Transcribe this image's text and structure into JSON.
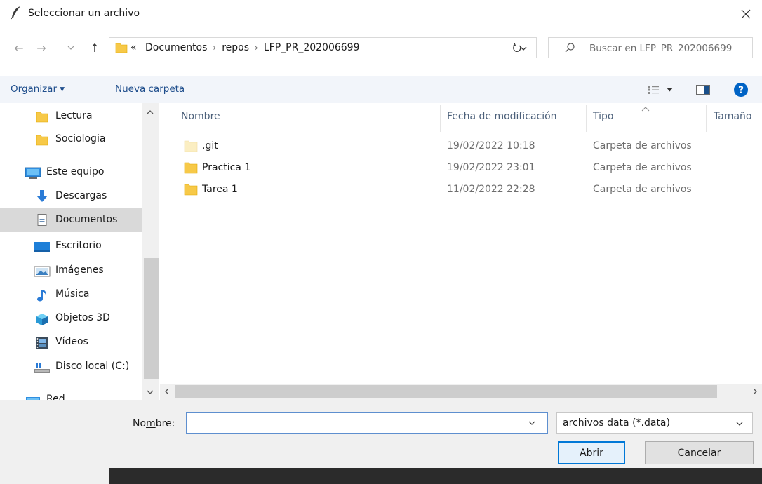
{
  "window": {
    "title": "Seleccionar un archivo",
    "close_glyph": "✕"
  },
  "nav": {
    "back_glyph": "←",
    "forward_glyph": "→",
    "recent_glyph": "⌄",
    "up_glyph": "↑",
    "address": {
      "prefix": "«",
      "crumbs": [
        "Documentos",
        "repos",
        "LFP_PR_202006699"
      ],
      "separator": "›"
    },
    "refresh_glyph": "↻",
    "search_placeholder": "Buscar en LFP_PR_202006699"
  },
  "toolbar": {
    "organize": "Organizar ▾",
    "new_folder": "Nueva carpeta",
    "help": "?"
  },
  "sidebar": {
    "items": [
      {
        "label": "Lectura",
        "icon": "folder-icon"
      },
      {
        "label": "Sociologia",
        "icon": "folder-icon"
      },
      {
        "label": "Este equipo",
        "icon": "computer-icon"
      },
      {
        "label": "Descargas",
        "icon": "download-icon"
      },
      {
        "label": "Documentos",
        "icon": "documents-icon",
        "selected": true
      },
      {
        "label": "Escritorio",
        "icon": "desktop-icon"
      },
      {
        "label": "Imágenes",
        "icon": "pictures-icon"
      },
      {
        "label": "Música",
        "icon": "music-icon"
      },
      {
        "label": "Objetos 3D",
        "icon": "objects-3d-icon"
      },
      {
        "label": "Vídeos",
        "icon": "videos-icon"
      },
      {
        "label": "Disco local (C:)",
        "icon": "drive-icon"
      },
      {
        "label": "Red",
        "icon": "network-icon"
      }
    ]
  },
  "columns": {
    "name": "Nombre",
    "date": "Fecha de modificación",
    "type": "Tipo",
    "size": "Tamaño"
  },
  "files": [
    {
      "name": ".git",
      "date": "19/02/2022 10:18",
      "type": "Carpeta de archivos",
      "hidden": true
    },
    {
      "name": "Practica 1",
      "date": "19/02/2022 23:01",
      "type": "Carpeta de archivos"
    },
    {
      "name": "Tarea 1",
      "date": "11/02/2022 22:28",
      "type": "Carpeta de archivos"
    }
  ],
  "bottom": {
    "filename_label_pre": "No",
    "filename_label_accel": "m",
    "filename_label_post": "bre:",
    "filename_value": "",
    "filter": "archivos data (*.data)",
    "open_accel": "A",
    "open_rest": "brir",
    "cancel": "Cancelar"
  },
  "colors": {
    "accent": "#0078d7",
    "folder": "#f7c948",
    "link": "#1f4e8c"
  }
}
